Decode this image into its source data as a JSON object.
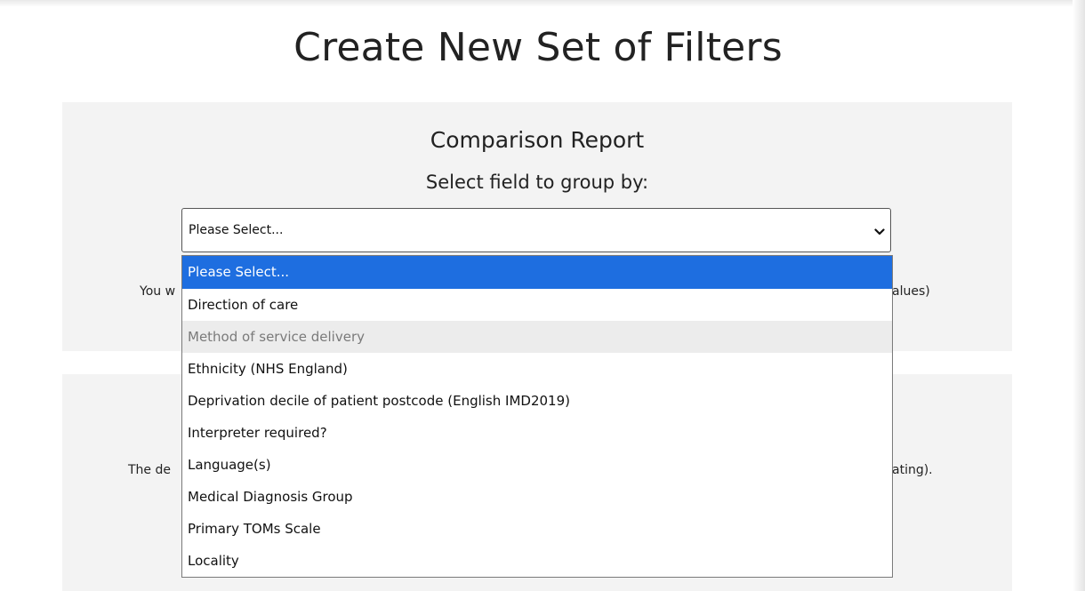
{
  "page": {
    "title": "Create New Set of Filters"
  },
  "comparison": {
    "title": "Comparison Report",
    "group_label": "Select field to group by:",
    "hint_left": "You w",
    "hint_right": "alues)"
  },
  "second_section": {
    "hint_left": "The de",
    "hint_right": "ating)."
  },
  "group_select": {
    "value": "Please Select...",
    "options": [
      "Please Select...",
      "Direction of care",
      "Method of service delivery",
      "Ethnicity (NHS England)",
      "Deprivation decile of patient postcode (English IMD2019)",
      "Interpreter required?",
      "Language(s)",
      "Medical Diagnosis Group",
      "Primary TOMs Scale",
      "Locality"
    ],
    "selected_index": 0,
    "disabled_option": "Method of service delivery",
    "icon": "chevron-down-icon"
  },
  "colors": {
    "highlight": "#1e6ee0",
    "panel_bg": "#f3f3f3",
    "disabled_bg": "#ececec"
  }
}
